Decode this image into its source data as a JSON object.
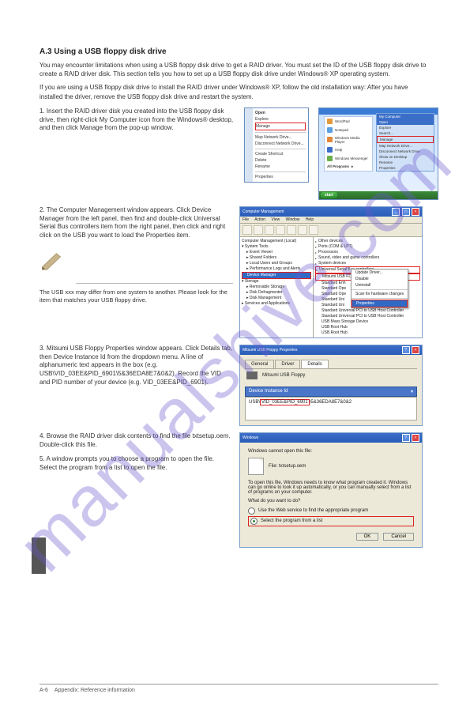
{
  "watermark": "manualshive.com",
  "heading": "A.3 Using a USB floppy disk drive",
  "intro1": "You may encounter limitations when using a USB floppy disk drive to get a RAID driver. You must set the ID of the USB floppy disk drive to create a RAID driver disk. This section tells you how to set up a USB floppy disk drive under Windows® XP operating system.",
  "intro2": "If you are using a USB floppy disk drive to install the RAID driver under Windows® XP, follow the old installation way:\nAfter you have installed the driver, remove the USB floppy disk drive and restart the system.",
  "step1": {
    "num": "1.",
    "text": "Insert the RAID driver disk you created into the USB floppy disk drive, then right-click My Computer icon from the Windows® desktop, and then click Manage from the pop-up window."
  },
  "ctx_menu": {
    "items": [
      "Open",
      "Explore",
      "Manage",
      "Map Network Drive...",
      "Disconnect Network Drive...",
      "Create Shortcut",
      "Delete",
      "Rename",
      "Properties"
    ],
    "highlighted": "Manage"
  },
  "start_menu": {
    "title": "My Computer",
    "left_items": [
      "WordPad",
      "Notepad",
      "Windows Media Player",
      "Help",
      "Windows Messenger",
      "All Programs"
    ],
    "right_items": [
      "Open",
      "Explore",
      "Search...",
      "Manage",
      "Map Network Drive...",
      "Disconnect Network Drive",
      "Show on Desktop",
      "Rename",
      "Properties"
    ],
    "start_label": "start",
    "highlighted": "Manage"
  },
  "step2": {
    "num": "2.",
    "text": "The Computer Management window appears. Click Device Manager from the left panel, then find and double-click Universal Serial Bus controllers item from the right panel, then click and right click on the USB you want to load the Properties item."
  },
  "note": "The USB xxx may differ from one system to another. Please look for the item that matches your USB floppy drive.",
  "compmgmt": {
    "title": "Computer Management",
    "menu": [
      "File",
      "Action",
      "View",
      "Window",
      "Help"
    ],
    "tree": [
      "Computer Management (Local)",
      "System Tools",
      "Event Viewer",
      "Shared Folders",
      "Local Users and Groups",
      "Performance Logs and Alerts",
      "Device Manager",
      "Storage",
      "Removable Storage",
      "Disk Defragmenter",
      "Disk Management",
      "Services and Applications"
    ],
    "tree_selected": "Device Manager",
    "right": [
      "Other devices",
      "Ports (COM & LPT)",
      "Processors",
      "Sound, video and game controllers",
      "System devices",
      "Universal Serial Bus controllers",
      "Mitsumi USB FD",
      "Standard Enh",
      "Standard Ope",
      "Standard Ope",
      "Standard Uni",
      "Standard Uni",
      "Standard Universal PCI to USB Host Controller",
      "Standard Universal PCI to USB Host Controller",
      "USB Mass Storage Device",
      "USB Root Hub",
      "USB Root Hub"
    ],
    "ctx": [
      "Update Driver...",
      "Disable",
      "Uninstall",
      "Scan for hardware changes",
      "Properties"
    ],
    "ctx_selected": "Properties",
    "usb_label": "Universal Serial Bus controllers"
  },
  "step3": {
    "num": "3.",
    "text": "Mitsumi USB Floppy Properties window appears. Click Details tab, then Device Instance Id from the dropdown menu. A line of alphanumeric text appears in the box (e.g. USB\\VID_03EE&PID_6901\\5&36EDA8E7&0&2). Record the VID and PID number of your device (e.g. VID_03EE&PID_6901)."
  },
  "propdlg": {
    "title": "Mitsumi USB Floppy Properties",
    "tabs": [
      "General",
      "Driver",
      "Details"
    ],
    "active_tab": "Details",
    "device_name": "Mitsumi USB Floppy",
    "combo": "Device Instance Id",
    "value": "USB\\VID_03EE&PID_6901\\5&36EDA8E7&0&2",
    "value_prefix": "USB\\",
    "value_boxed": "VID_03EE&PID_6901",
    "value_suffix": "\\5&36EDA8E7&0&2"
  },
  "step4": {
    "num": "4.",
    "text": "Browse the RAID driver disk contents to find the file txtsetup.oem. Double-click this file."
  },
  "step5": {
    "num": "5.",
    "text": "A window prompts you to choose a program to open the file. Select the program from a list to open the file."
  },
  "opendlg": {
    "title": "Windows",
    "cannot_open": "Windows cannot open this file:",
    "file_label": "File:",
    "file_name": "txtsetup.oem",
    "explain": "To open this file, Windows needs to know what program created it. Windows can go online to look it up automatically, or you can manually select from a list of programs on your computer.",
    "question": "What do you want to do?",
    "opt1": "Use the Web service to find the appropriate program",
    "opt2": "Select the program from a list",
    "ok": "OK",
    "cancel": "Cancel"
  },
  "footer": {
    "page": "A-6",
    "label": "Appendix: Reference information"
  }
}
